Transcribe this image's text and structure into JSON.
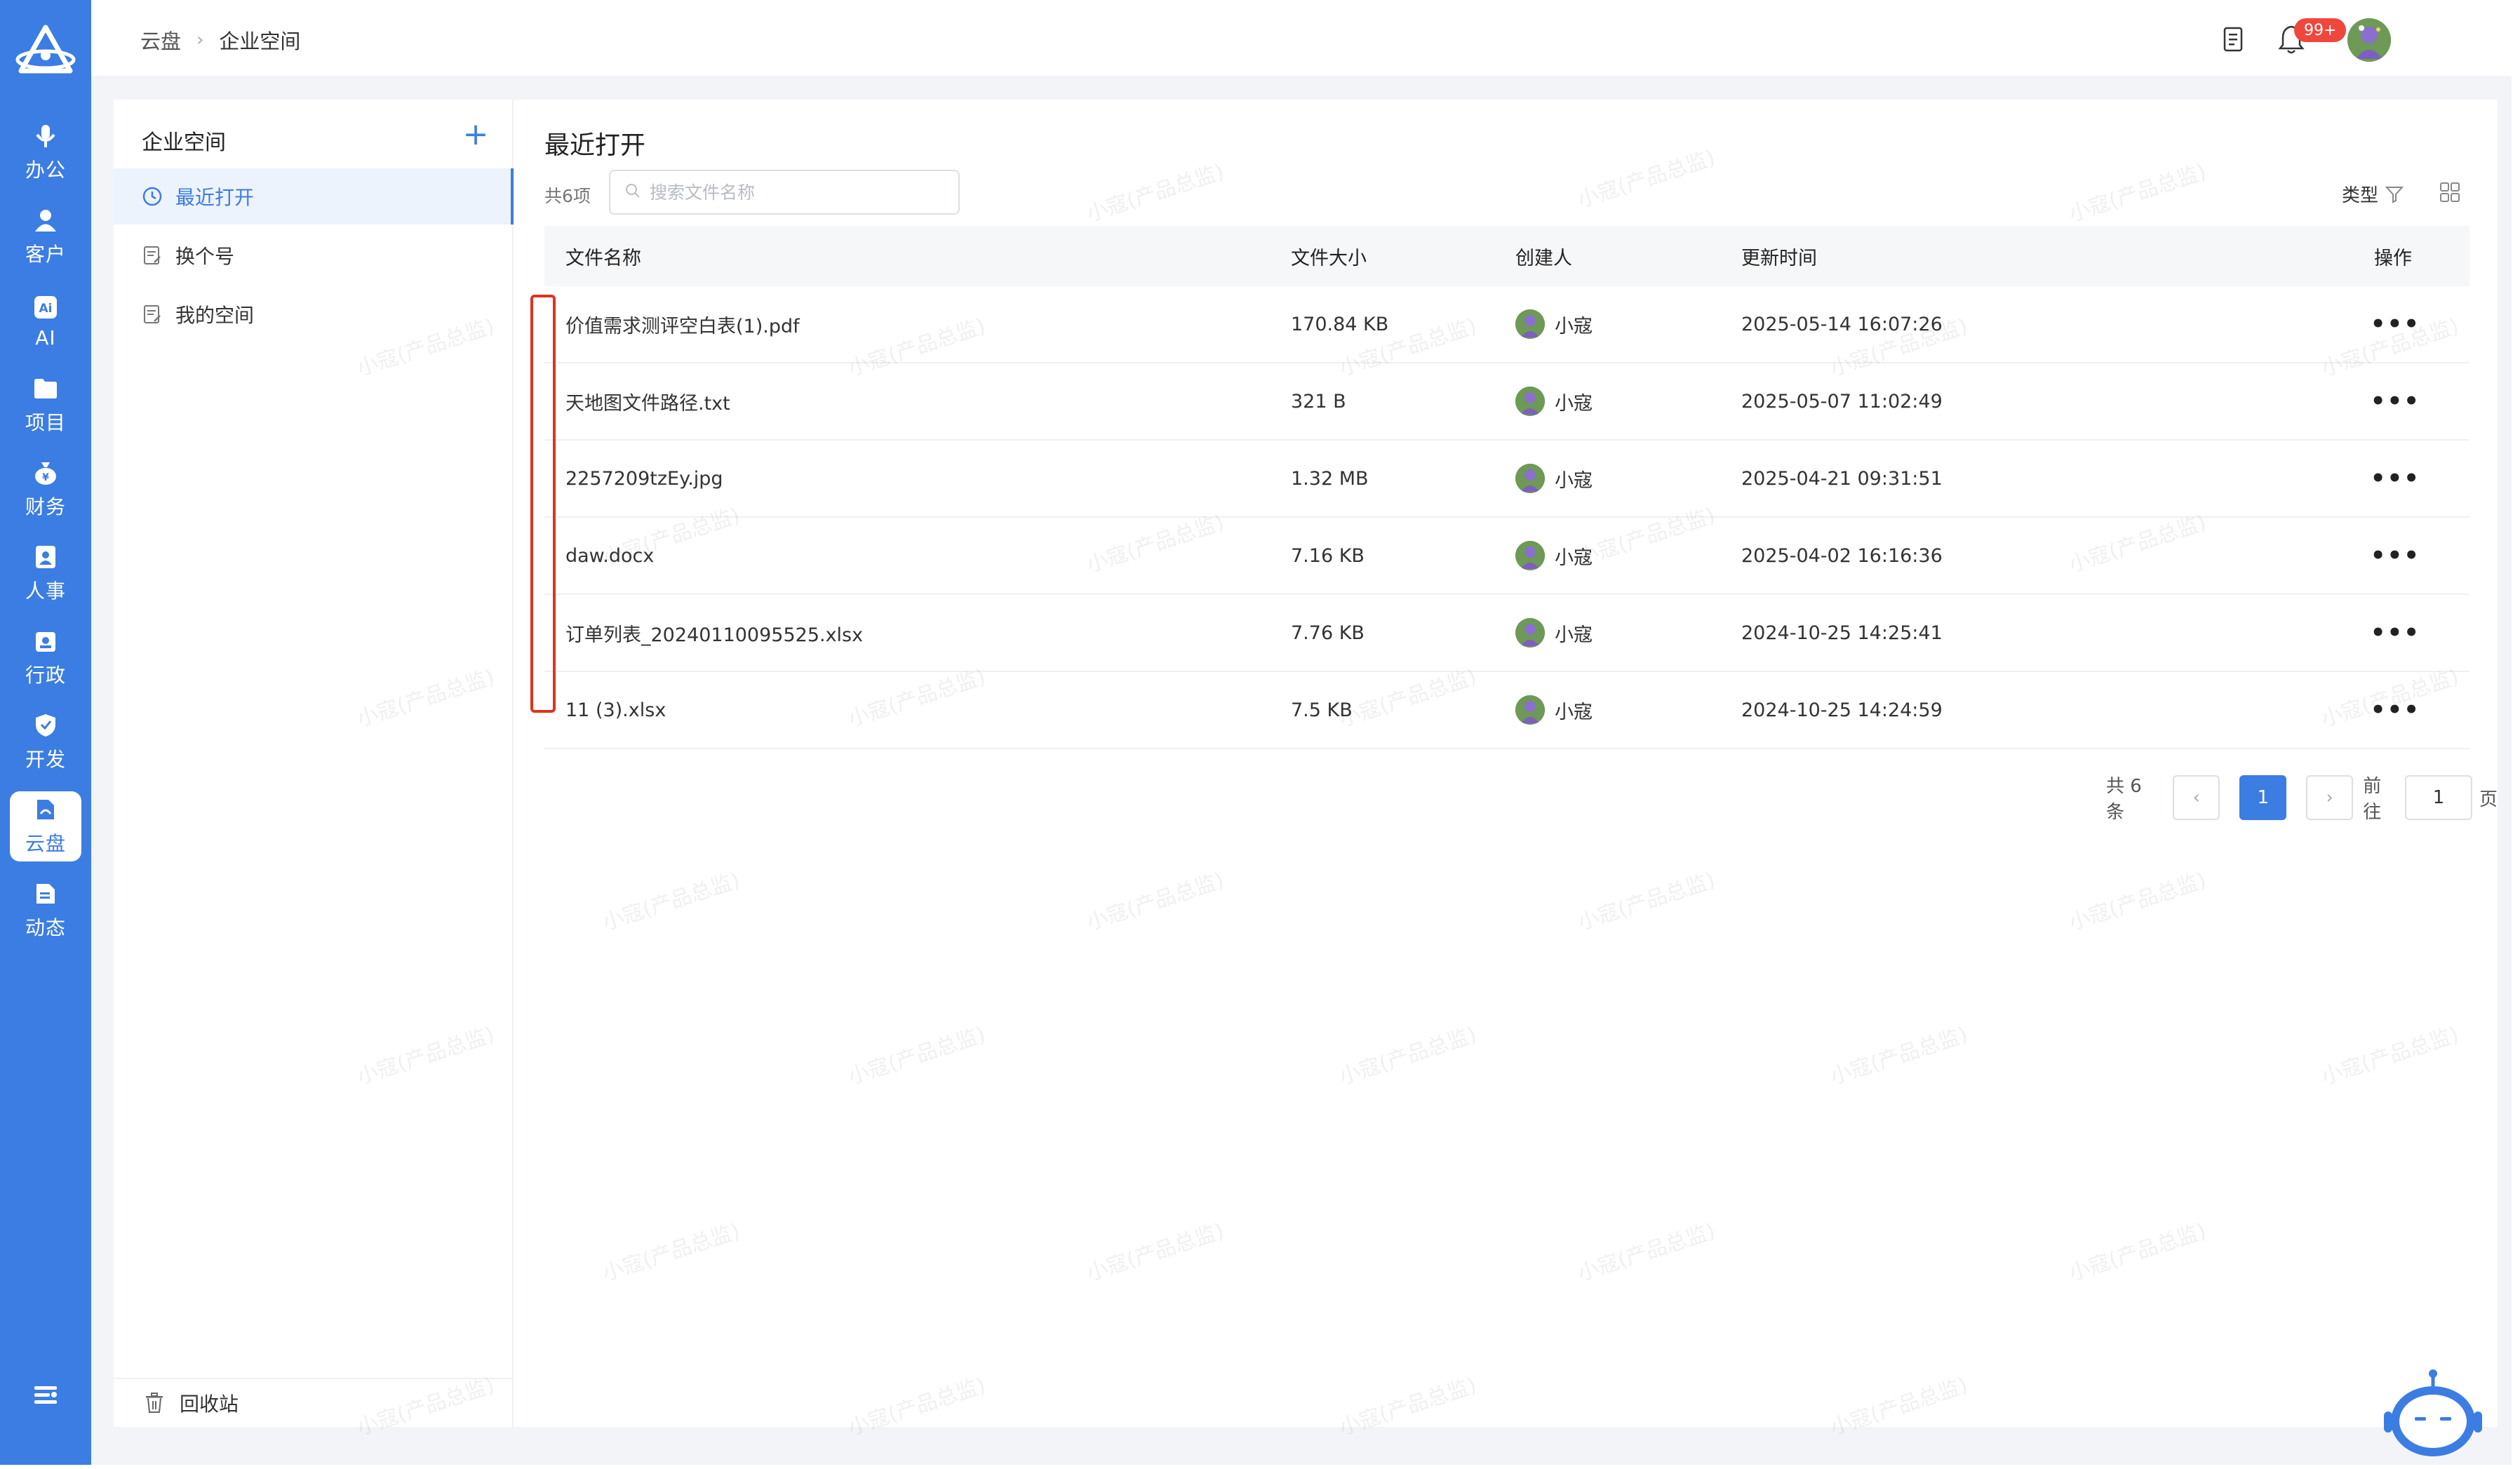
{
  "rail": {
    "items": [
      {
        "label": "办公",
        "icon": "mic-icon"
      },
      {
        "label": "客户",
        "icon": "user-icon"
      },
      {
        "label": "AI",
        "icon": "ai-icon"
      },
      {
        "label": "项目",
        "icon": "folder-icon"
      },
      {
        "label": "财务",
        "icon": "money-bag-icon"
      },
      {
        "label": "人事",
        "icon": "id-badge-icon"
      },
      {
        "label": "行政",
        "icon": "admin-icon"
      },
      {
        "label": "开发",
        "icon": "shield-icon"
      },
      {
        "label": "云盘",
        "icon": "cloud-drive-icon"
      },
      {
        "label": "动态",
        "icon": "feed-icon"
      }
    ],
    "active_index": 8
  },
  "header": {
    "breadcrumb": [
      "云盘",
      "企业空间"
    ],
    "notification_badge": "99+"
  },
  "space_nav": {
    "title": "企业空间",
    "items": [
      {
        "label": "最近打开",
        "icon": "clock-icon"
      },
      {
        "label": "换个号",
        "icon": "doc-edit-icon"
      },
      {
        "label": "我的空间",
        "icon": "doc-edit-icon"
      }
    ],
    "recycle_label": "回收站"
  },
  "main": {
    "title": "最近打开",
    "total_label": "共6项",
    "search_placeholder": "搜索文件名称",
    "type_filter_label": "类型"
  },
  "table": {
    "columns": [
      "文件名称",
      "文件大小",
      "创建人",
      "更新时间",
      "操作"
    ],
    "rows": [
      {
        "name": "价值需求测评空白表(1).pdf",
        "size": "170.84 KB",
        "creator": "小寇",
        "updated": "2025-05-14 16:07:26"
      },
      {
        "name": "天地图文件路径.txt",
        "size": "321 B",
        "creator": "小寇",
        "updated": "2025-05-07 11:02:49"
      },
      {
        "name": "2257209tzEy.jpg",
        "size": "1.32 MB",
        "creator": "小寇",
        "updated": "2025-04-21 09:31:51"
      },
      {
        "name": "daw.docx",
        "size": "7.16 KB",
        "creator": "小寇",
        "updated": "2025-04-02 16:16:36"
      },
      {
        "name": "订单列表_20240110095525.xlsx",
        "size": "7.76 KB",
        "creator": "小寇",
        "updated": "2024-10-25 14:25:41"
      },
      {
        "name": "11 (3).xlsx",
        "size": "7.5 KB",
        "creator": "小寇",
        "updated": "2024-10-25 14:24:59"
      }
    ],
    "more_glyph": "•••"
  },
  "pagination": {
    "total_label": "共 6 条",
    "current_page": "1",
    "goto_prefix": "前往",
    "goto_value": "1",
    "goto_suffix": "页"
  },
  "watermark_text": "小寇(产品总监)",
  "colors": {
    "primary": "#3b7de2",
    "highlight": "#e0321e",
    "badge": "#f0473d"
  }
}
